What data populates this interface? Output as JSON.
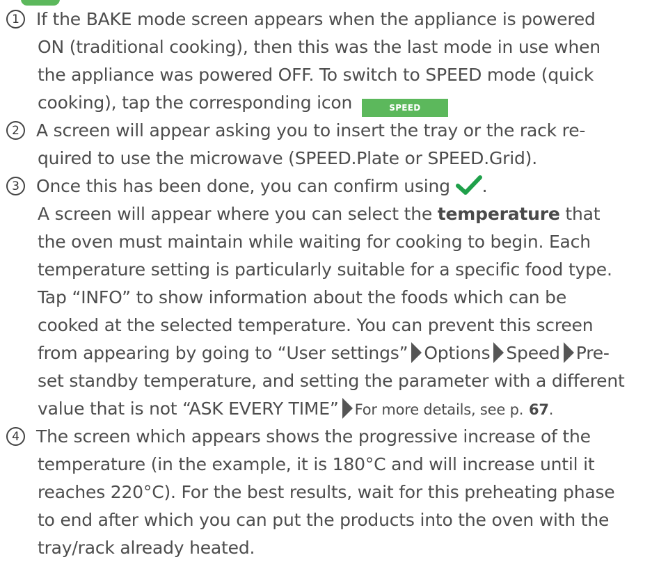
{
  "accent_color": "#5cb85c",
  "steps": [
    {
      "number": "1",
      "line1": "If the BAKE mode screen appears when the appliance is powered",
      "line2": "ON (traditional cooking), then this was the last mode in use when",
      "line3": "the appliance was powered OFF. To switch to SPEED mode (quick",
      "line4": "cooking), tap the corresponding icon",
      "badge": "SPEED"
    },
    {
      "number": "2",
      "line1": "A screen will appear asking you to insert the tray or the rack re-",
      "line2": "quired to use the microwave (SPEED.Plate or SPEED.Grid)."
    },
    {
      "number": "3",
      "line1": "Once this has been done, you can confirm using",
      "line1_end": ".",
      "line2_pre": "A screen will appear where you can select the",
      "line2_bold": "temperature",
      "line2_post": "that",
      "line3": "the oven must maintain while waiting for cooking to begin. Each",
      "line4": "temperature setting is particularly suitable for a specific food type.",
      "line5": "Tap “INFO” to show information about the foods which can be",
      "line6": "cooked at the selected temperature. You can prevent this screen",
      "line7_a": "from appearing by going to “User settings”",
      "line7_b": "Options",
      "line7_c": "Speed",
      "line7_d": "Pre-",
      "line8": "set standby temperature, and setting the parameter with a different",
      "line9_a": "value that is not “ASK EVERY TIME”",
      "line9_ref": "For more details, see p.",
      "line9_page": "67",
      "line9_end": "."
    },
    {
      "number": "4",
      "line1": "The screen which appears shows the progressive increase of the",
      "line2": "temperature (in the example, it is 180°C and will increase until it",
      "line3": "reaches 220°C). For the best results, wait for this preheating phase",
      "line4": "to end after which you can put the products into the oven with the",
      "line5": "tray/rack already heated."
    }
  ]
}
